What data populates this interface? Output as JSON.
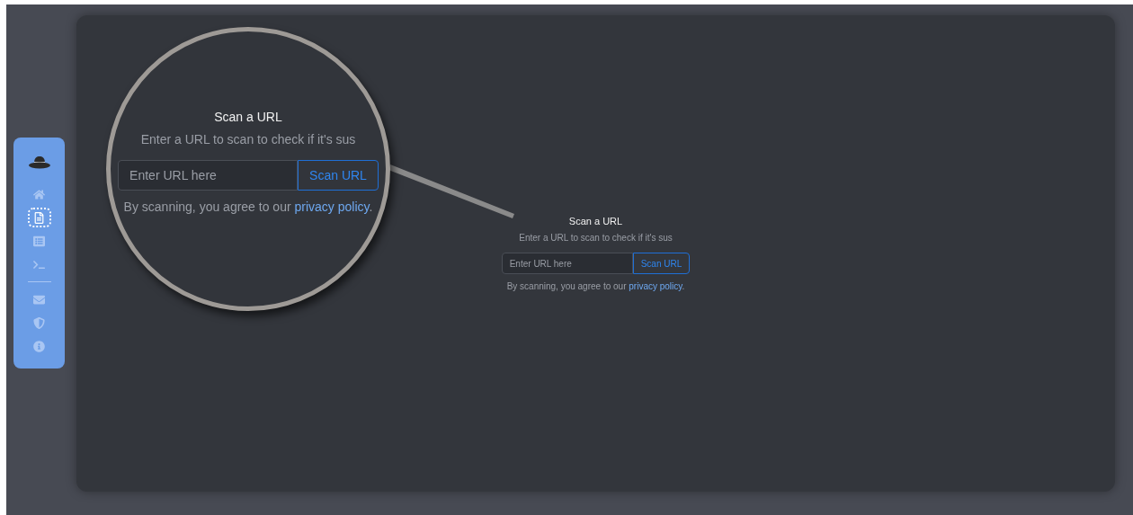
{
  "sidebar": {
    "items": [
      {
        "kind": "logo"
      },
      {
        "kind": "home",
        "selected": false
      },
      {
        "kind": "document",
        "selected": true
      },
      {
        "kind": "list",
        "selected": false
      },
      {
        "kind": "terminal",
        "selected": false
      },
      {
        "kind": "divider"
      },
      {
        "kind": "mail",
        "selected": false
      },
      {
        "kind": "shield",
        "selected": false
      },
      {
        "kind": "info",
        "selected": false
      }
    ]
  },
  "scan_form": {
    "title": "Scan a URL",
    "subtitle": "Enter a URL to scan to check if it's sus",
    "placeholder": "Enter URL here",
    "button": "Scan URL",
    "notice": "By scanning, you agree to our",
    "link": "privacy policy",
    "after_link": "."
  },
  "magnifier": {
    "title": "Scan a URL",
    "subtitle": "Enter a URL to scan to check if it's sus",
    "placeholder": "Enter URL here",
    "button": "Scan URL",
    "notice": "By scanning, you agree to our",
    "link": "privacy policy",
    "after_link": "."
  }
}
